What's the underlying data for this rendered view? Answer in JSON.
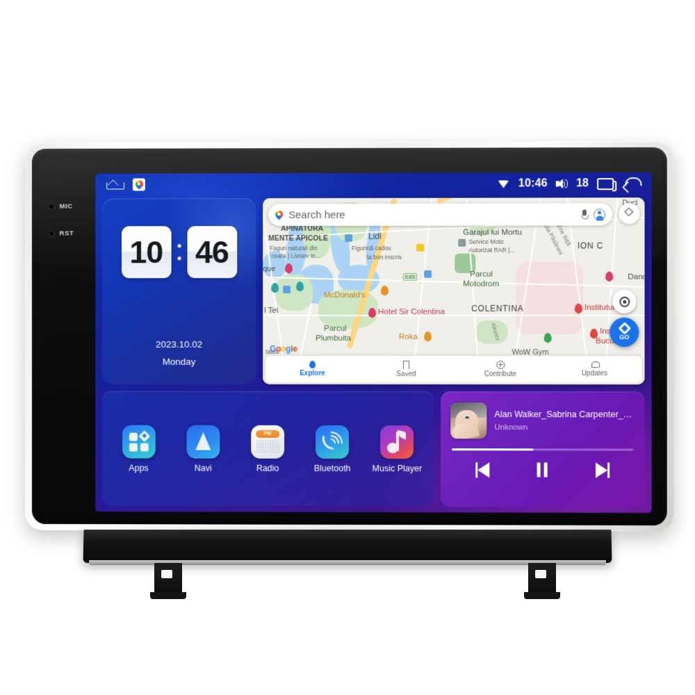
{
  "device": {
    "side_buttons": [
      {
        "label": "MIC",
        "icon": "mic-hole-icon"
      },
      {
        "label": "RST",
        "icon": "reset-hole-icon"
      }
    ]
  },
  "statusbar": {
    "home_icon": "home-icon",
    "maps_app_icon": "google-maps-icon",
    "wifi_icon": "wifi-icon",
    "time": "10:46",
    "volume_icon": "volume-icon",
    "volume_level": "18",
    "recents_icon": "recents-icon",
    "back_icon": "back-arrow-icon"
  },
  "clock_widget": {
    "hours": "10",
    "minutes": "46",
    "date": "2023.10.02",
    "weekday": "Monday"
  },
  "map_widget": {
    "search": {
      "placeholder": "Search here",
      "pin_icon": "google-maps-pin-icon",
      "mic_icon": "microphone-icon",
      "account_icon": "account-avatar-icon"
    },
    "layers_icon": "map-layers-icon",
    "locate_icon": "my-location-icon",
    "go_button": {
      "label": "GO",
      "icon": "navigation-diamond-icon"
    },
    "attribution": "Google",
    "labels": [
      {
        "text": "APINATURA",
        "style": "dark"
      },
      {
        "text": "MENTE APICOLE",
        "style": "dark"
      },
      {
        "text": "Faguri naturali din",
        "style": "small"
      },
      {
        "text": "ceara | Livrare in...",
        "style": "small"
      },
      {
        "text": "Lidl",
        "style": "dark"
      },
      {
        "text": "Figurină cadou",
        "style": "small"
      },
      {
        "text": "la bon inscris",
        "style": "small"
      },
      {
        "text": "Garajul lui Mortu",
        "style": "dark"
      },
      {
        "text": "Service Moto",
        "style": "small"
      },
      {
        "text": "Autorizat RAR |...",
        "style": "small"
      },
      {
        "text": "ION C",
        "style": "big"
      },
      {
        "text": "Parcul",
        "style": "green"
      },
      {
        "text": "Motodrom",
        "style": "green"
      },
      {
        "text": "COLENTINA",
        "style": "big"
      },
      {
        "text": "McDonald's",
        "style": "biz"
      },
      {
        "text": "Hotel Sir Colentina",
        "style": "pink"
      },
      {
        "text": "Parcul",
        "style": "green"
      },
      {
        "text": "Plumbuita",
        "style": "green"
      },
      {
        "text": "Roka",
        "style": "biz"
      },
      {
        "text": "l Tei",
        "style": "dark"
      },
      {
        "text": "que",
        "style": "dark"
      },
      {
        "text": "Institutul",
        "style": "red"
      },
      {
        "text": "Instit",
        "style": "red"
      },
      {
        "text": "Bucure",
        "style": "red"
      },
      {
        "text": "Danc",
        "style": "dark"
      },
      {
        "text": "E85",
        "style": "shield"
      },
      {
        "text": "da Ene Niță",
        "style": "street"
      },
      {
        "text": "ada Păsărani",
        "style": "street"
      },
      {
        "text": "Aleelor",
        "style": "street"
      },
      {
        "text": "WoW Gym",
        "style": "dark"
      },
      {
        "text": "tatea",
        "style": "small"
      },
      {
        "text": "Ducl",
        "style": "dark"
      }
    ],
    "bottom_nav": [
      {
        "label": "Explore",
        "icon": "explore-pin-icon",
        "active": true
      },
      {
        "label": "Saved",
        "icon": "bookmark-icon",
        "active": false
      },
      {
        "label": "Contribute",
        "icon": "plus-circle-icon",
        "active": false
      },
      {
        "label": "Updates",
        "icon": "bell-icon",
        "active": false
      }
    ]
  },
  "app_shortcuts": [
    {
      "label": "Apps",
      "icon": "apps-grid-icon"
    },
    {
      "label": "Navi",
      "icon": "navigation-arrow-icon"
    },
    {
      "label": "Radio",
      "icon": "fm-radio-icon",
      "badge": "FM"
    },
    {
      "label": "Bluetooth",
      "icon": "bluetooth-phone-icon"
    },
    {
      "label": "Music Player",
      "icon": "music-note-icon"
    }
  ],
  "music_widget": {
    "album_art_icon": "album-art-thumbnail",
    "title": "Alan Walker_Sabrina Carpenter_F...",
    "artist": "Unknown",
    "progress_percent": 45,
    "controls": [
      {
        "name": "previous",
        "icon": "skip-previous-icon"
      },
      {
        "name": "pause",
        "icon": "pause-icon"
      },
      {
        "name": "next",
        "icon": "skip-next-icon"
      }
    ]
  },
  "colors": {
    "screen_blue": "#1338c9",
    "screen_purple": "#5a1385",
    "accent_blue": "#1a73e8",
    "music_purple": "#6b21bc"
  }
}
